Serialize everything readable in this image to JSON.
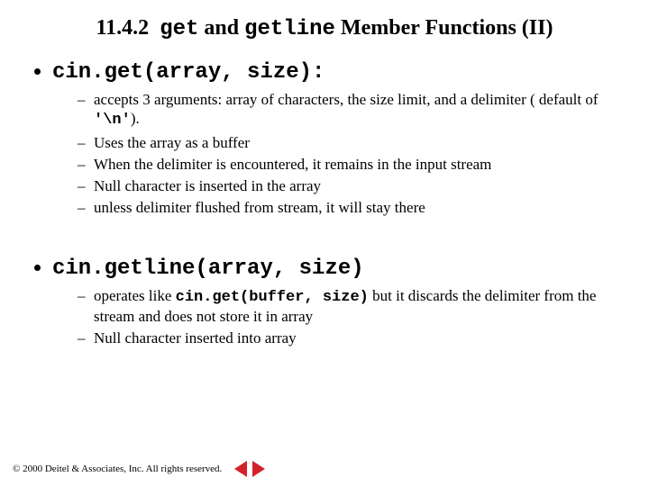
{
  "title": {
    "section": "11.4.2",
    "code1": "get",
    "mid": " and ",
    "code2": "getline",
    "rest": " Member Functions (II)"
  },
  "bullets": [
    {
      "code": "cin.get(array, size):",
      "subs": [
        {
          "pre": "accepts 3 arguments: array of characters, the size limit, and a delimiter ( default of ",
          "code": "'\\n'",
          "post": ")."
        },
        {
          "pre": "Uses the array as a buffer",
          "code": "",
          "post": ""
        },
        {
          "pre": "When the delimiter is encountered, it remains in the input stream",
          "code": "",
          "post": ""
        },
        {
          "pre": "Null character is inserted in the array",
          "code": "",
          "post": ""
        },
        {
          "pre": "unless delimiter flushed from stream, it will stay there",
          "code": "",
          "post": ""
        }
      ]
    },
    {
      "code": "cin.getline(array, size)",
      "subs": [
        {
          "pre": "operates like ",
          "code": "cin.get(buffer, size)",
          "post": " but it discards the delimiter from the stream and does not store it in array"
        },
        {
          "pre": "Null character inserted into array",
          "code": "",
          "post": ""
        }
      ]
    }
  ],
  "footer": {
    "copyright": "© 2000 Deitel & Associates, Inc.  All rights reserved."
  }
}
